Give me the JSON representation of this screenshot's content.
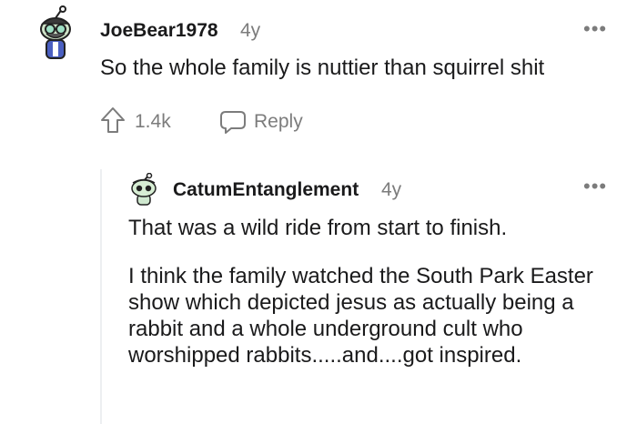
{
  "comment": {
    "username": "JoeBear1978",
    "age": "4y",
    "body": "So the whole family is nuttier than squirrel shit",
    "votes": "1.4k",
    "reply_label": "Reply",
    "more_label": "•••",
    "avatar_icon": "snoo-avatar-icon",
    "reply": {
      "username": "CatumEntanglement",
      "age": "4y",
      "more_label": "•••",
      "avatar_icon": "snoo-avatar-icon",
      "paragraphs": [
        "That was a wild ride from start to finish.",
        "I think the family watched the South Park Easter show which depicted jesus as actually being a rabbit and a whole underground cult who worshipped rabbits.....and....got inspired."
      ]
    }
  },
  "colors": {
    "text": "#1a1a1b",
    "meta": "#7c7c7c",
    "thread_line": "#edeff1"
  }
}
